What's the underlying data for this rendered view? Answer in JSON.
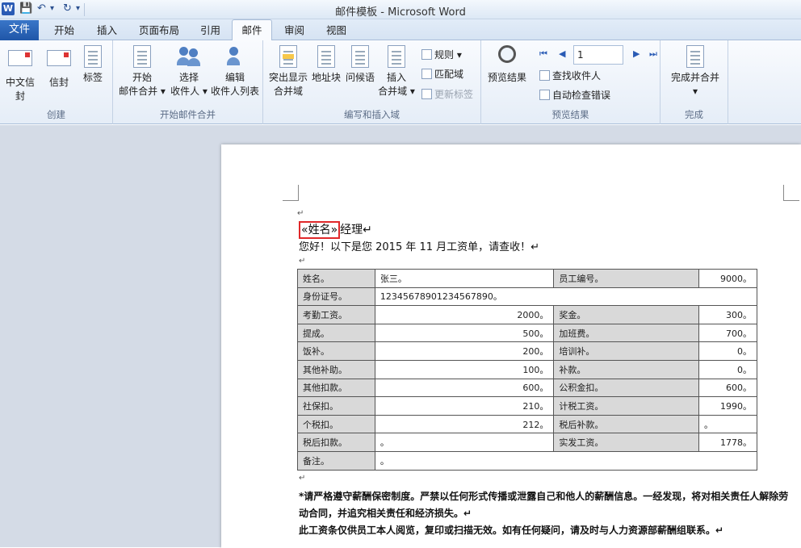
{
  "window": {
    "title": "邮件模板 - Microsoft Word",
    "app_icon": "W"
  },
  "quick_access": {
    "save_icon": "💾",
    "undo_icon": "↶",
    "undo_arrow": "▾",
    "redo_icon": "↻",
    "more": "▾"
  },
  "tabs": [
    "文件",
    "开始",
    "插入",
    "页面布局",
    "引用",
    "邮件",
    "审阅",
    "视图"
  ],
  "ribbon": {
    "create": {
      "label": "创建",
      "btn1": "中文信封",
      "btn2": "信封",
      "btn3": "标签"
    },
    "start_merge": {
      "label": "开始邮件合并",
      "btn1a": "开始",
      "btn1b": "邮件合并 ▾",
      "btn2a": "选择",
      "btn2b": "收件人 ▾",
      "btn3a": "编辑",
      "btn3b": "收件人列表"
    },
    "write_insert": {
      "label": "编写和插入域",
      "btn1a": "突出显示",
      "btn1b": "合并域",
      "btn2": "地址块",
      "btn3": "问候语",
      "btn4a": "插入",
      "btn4b": "合并域 ▾",
      "rules": "规则 ▾",
      "match": "匹配域",
      "update": "更新标签"
    },
    "preview": {
      "label": "预览结果",
      "btn1": "预览结果",
      "record": "1",
      "find": "查找收件人",
      "check": "自动检查错误"
    },
    "finish": {
      "label": "完成",
      "btn1": "完成并合并",
      "arrow": "▾"
    }
  },
  "nav": {
    "first": "⏮",
    "prev": "◀",
    "next": "▶",
    "last": "⏭"
  },
  "document": {
    "para_mark": "↵",
    "field": "«姓名»",
    "greeting_suffix": "经理↵",
    "line2": "您好！以下是您 2015 年 11 月工资单，请查收！↵",
    "table": [
      [
        "姓名。",
        "张三。",
        "员工编号。",
        "9000。"
      ],
      [
        "身份证号。",
        "12345678901234567890。",
        "",
        ""
      ],
      [
        "考勤工资。",
        "2000。",
        "奖金。",
        "300。"
      ],
      [
        "提成。",
        "500。",
        "加班费。",
        "700。"
      ],
      [
        "饭补。",
        "200。",
        "培训补。",
        "0。"
      ],
      [
        "其他补助。",
        "100。",
        "补款。",
        "0。"
      ],
      [
        "其他扣款。",
        "600。",
        "公积金扣。",
        "600。"
      ],
      [
        "社保扣。",
        "210。",
        "计税工资。",
        "1990。"
      ],
      [
        "个税扣。",
        "212。",
        "税后补款。",
        "。"
      ],
      [
        "税后扣款。",
        "。",
        "实发工资。",
        "1778。"
      ],
      [
        "备注。",
        "。",
        "",
        ""
      ]
    ],
    "row_end": "↵",
    "note1": "*请严格遵守薪酬保密制度。严禁以任何形式传播或泄露自己和他人的薪酬信息。一经发现，将对相关责任人解除劳动合同，并追究相关责任和经济损失。↵",
    "note2": "此工资条仅供员工本人阅览，复印或扫描无效。如有任何疑问，请及时与人力资源部薪酬组联系。↵"
  }
}
